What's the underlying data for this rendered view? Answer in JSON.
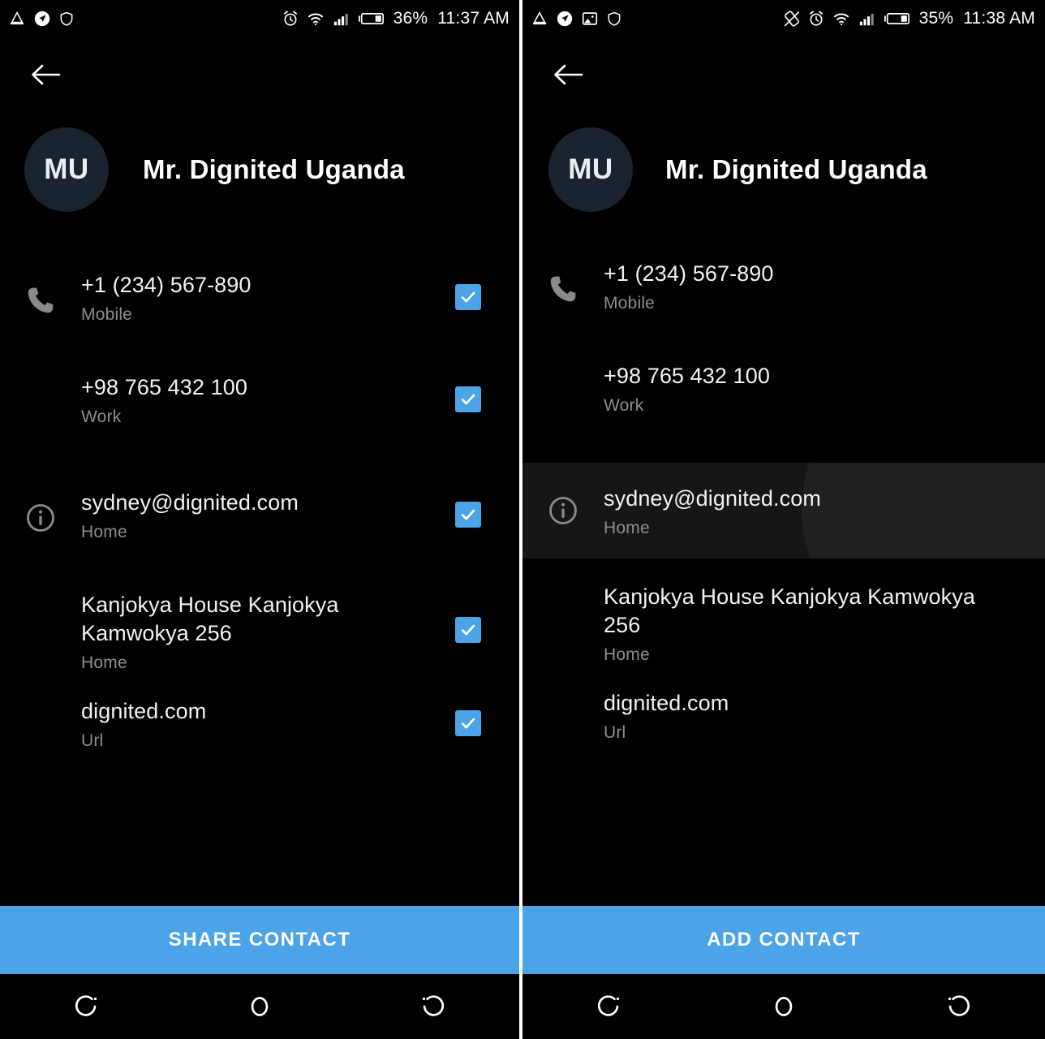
{
  "left": {
    "statusbar": {
      "icons_left": [
        "drive-mode-icon",
        "location-arrow-icon",
        "shield-icon"
      ],
      "icons_right": [
        "alarm-icon",
        "wifi-icon",
        "signal-icon",
        "battery-icon"
      ],
      "battery_percent": "36%",
      "time": "11:37 AM"
    },
    "appbar": {
      "back_icon": "back-arrow-icon"
    },
    "contact": {
      "initials": "MU",
      "name": "Mr. Dignited Uganda",
      "avatar_color": "#1a2430"
    },
    "rows": [
      {
        "icon": "phone-icon",
        "value": "+1 (234) 567-890",
        "label": "Mobile",
        "checked": true
      },
      {
        "icon": "",
        "value": "+98 765 432 100",
        "label": "Work",
        "checked": true
      },
      {
        "icon": "info-icon",
        "value": "sydney@dignited.com",
        "label": "Home",
        "checked": true
      },
      {
        "icon": "",
        "value": "Kanjokya House Kanjokya Kamwokya 256",
        "label": "Home",
        "checked": true
      },
      {
        "icon": "",
        "value": "dignited.com",
        "label": "Url",
        "checked": true
      }
    ],
    "action": {
      "label": "SHARE CONTACT",
      "color": "#4ba3e8"
    },
    "navbar": [
      "recents-icon",
      "home-icon",
      "back-nav-icon"
    ]
  },
  "right": {
    "statusbar": {
      "icons_left": [
        "drive-mode-icon",
        "location-arrow-icon",
        "screenshot-icon",
        "shield-icon"
      ],
      "icons_right": [
        "rotation-locked-icon",
        "alarm-icon",
        "wifi-icon",
        "signal-icon",
        "battery-icon"
      ],
      "battery_percent": "35%",
      "time": "11:38 AM"
    },
    "appbar": {
      "back_icon": "back-arrow-icon"
    },
    "contact": {
      "initials": "MU",
      "name": "Mr. Dignited Uganda",
      "avatar_color": "#1a2430"
    },
    "rows": [
      {
        "icon": "phone-icon",
        "value": "+1 (234) 567-890",
        "label": "Mobile",
        "highlighted": false
      },
      {
        "icon": "",
        "value": "+98 765 432 100",
        "label": "Work",
        "highlighted": false
      },
      {
        "icon": "info-icon",
        "value": "sydney@dignited.com",
        "label": "Home",
        "highlighted": true
      },
      {
        "icon": "",
        "value": "Kanjokya House Kanjokya Kamwokya 256",
        "label": "Home",
        "highlighted": false
      },
      {
        "icon": "",
        "value": "dignited.com",
        "label": "Url",
        "highlighted": false
      }
    ],
    "action": {
      "label": "ADD CONTACT",
      "color": "#4ba3e8"
    },
    "navbar": [
      "recents-icon",
      "home-icon",
      "back-nav-icon"
    ]
  }
}
